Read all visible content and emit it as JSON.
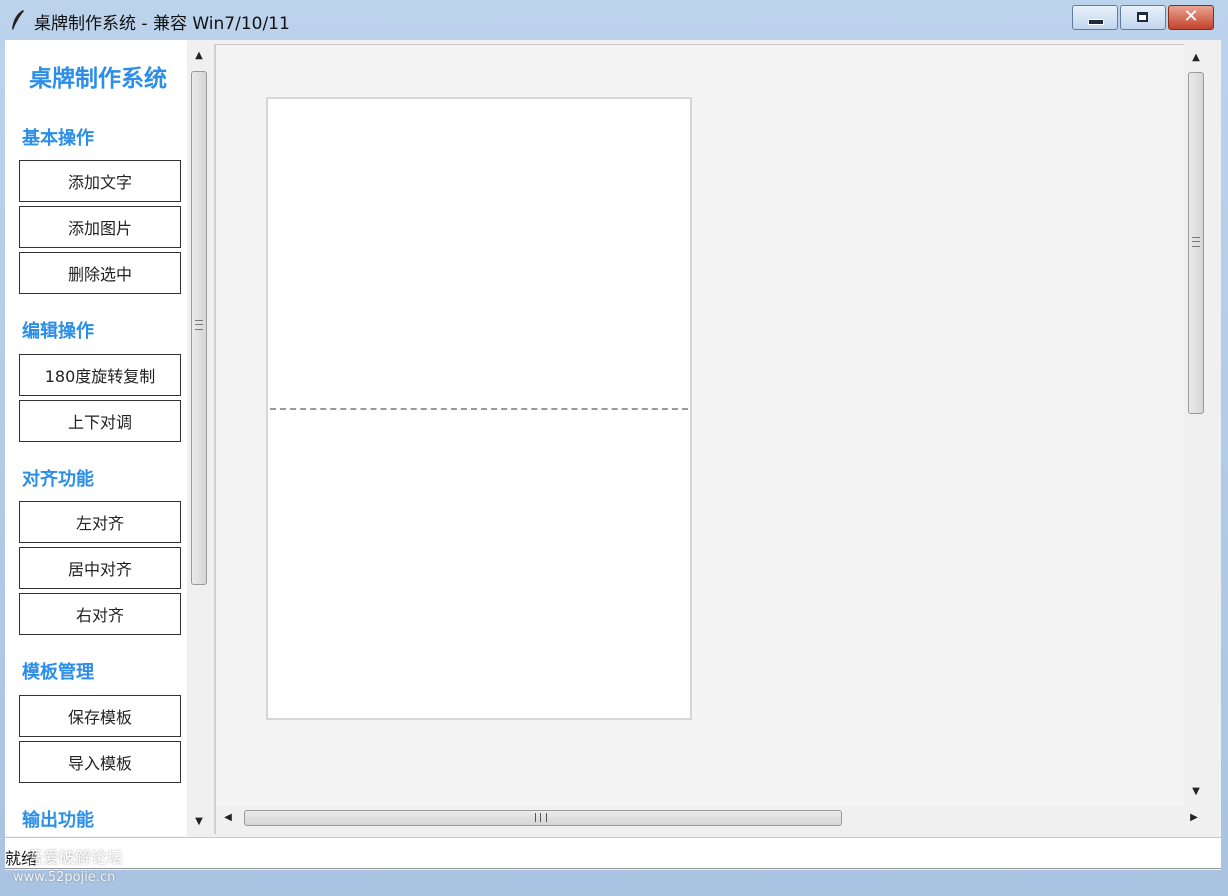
{
  "window": {
    "title": "桌牌制作系统 - 兼容 Win7/10/11",
    "minimize_glyph": "",
    "maximize_glyph": "",
    "close_glyph": "✕"
  },
  "sidebar": {
    "app_title": "桌牌制作系统",
    "sections": [
      {
        "title": "基本操作",
        "buttons": [
          "添加文字",
          "添加图片",
          "删除选中"
        ]
      },
      {
        "title": "编辑操作",
        "buttons": [
          "180度旋转复制",
          "上下对调"
        ]
      },
      {
        "title": "对齐功能",
        "buttons": [
          "左对齐",
          "居中对齐",
          "右对齐"
        ]
      },
      {
        "title": "模板管理",
        "buttons": [
          "保存模板",
          "导入模板"
        ]
      },
      {
        "title": "输出功能",
        "buttons": []
      }
    ]
  },
  "scroll": {
    "up": "▲",
    "down": "▼",
    "left": "◀",
    "right": "▶"
  },
  "status": {
    "text": "就绪",
    "watermark_line1": "吾爱破解论坛",
    "watermark_line2": "www.52pojie.cn"
  },
  "colors": {
    "accent": "#2b8ee8",
    "card_border": "#d6d6d6",
    "fold_line": "#999999"
  },
  "icons": {
    "app": "feather-icon"
  }
}
